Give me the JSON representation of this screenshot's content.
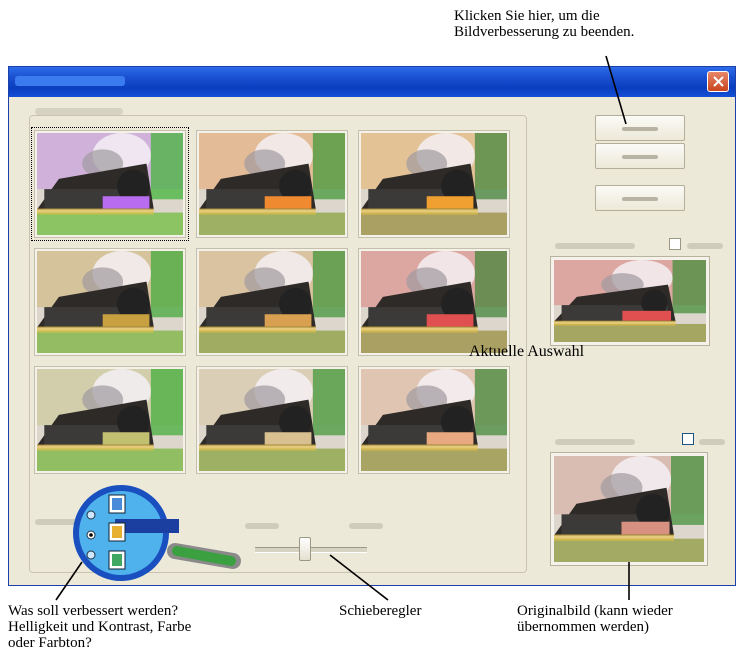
{
  "callouts": {
    "top_right": [
      "Klicken Sie hier, um die",
      "Bildverbesserung zu beenden."
    ],
    "bottom_left": [
      "Was soll verbessert werden?",
      "Helligkeit und Kontrast, Farbe",
      "oder Farbton?"
    ],
    "bottom_middle": "Schieberegler",
    "bottom_right": [
      "Originalbild (kann wieder",
      "übernommen werden)"
    ]
  },
  "window": {
    "close_icon": "close-icon",
    "current_selection_label": "Aktuelle Auswahl"
  },
  "thumbnails": [
    {
      "tint": "#b86cf0",
      "green": 0.9
    },
    {
      "tint": "#f08a30",
      "green": 0.55
    },
    {
      "tint": "#f0a030",
      "green": 0.3
    },
    {
      "tint": "#c8a040",
      "green": 0.75
    },
    {
      "tint": "#d8a050",
      "green": 0.5
    },
    {
      "tint": "#e05050",
      "green": 0.3
    },
    {
      "tint": "#c0c070",
      "green": 0.8
    },
    {
      "tint": "#d8c090",
      "green": 0.55
    },
    {
      "tint": "#e8a880",
      "green": 0.35
    }
  ],
  "colors": {
    "title_bar": "#0a3ebf",
    "window_bg": "#ece9d8",
    "close_button": "#c8441e"
  }
}
